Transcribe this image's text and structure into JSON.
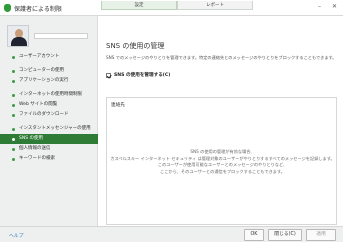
{
  "window": {
    "title": "保護者による制限",
    "controls": {
      "minimize": "–",
      "close": "✕"
    }
  },
  "tabs": [
    {
      "label": "設定"
    },
    {
      "label": "レポート"
    }
  ],
  "sidebar": {
    "username": "",
    "items": [
      {
        "label": "ユーザーアカウント"
      },
      {
        "label": "コンピューターの使用"
      },
      {
        "label": "アプリケーションの実行"
      },
      {
        "label": "インターネットの使用時間制限"
      },
      {
        "label": "Web サイトの閲覧"
      },
      {
        "label": "ファイルのダウンロード"
      },
      {
        "label": "インスタントメッセンジャーの使用"
      },
      {
        "label": "SNS の使用"
      },
      {
        "label": "個人情報の送信"
      },
      {
        "label": "キーワードの検索"
      }
    ],
    "active_index": 7
  },
  "content": {
    "heading": "SNS の使用の管理",
    "description": "SNS でのメッセージのやりとりを管理できます。特定の連絡先とのメッセージのやりとりをブロックすることもできます。",
    "checkbox_label": "SNS の使用を管理する(C)",
    "checkbox_checked": true,
    "contacts_label": "連絡先",
    "contacts_empty_lines": [
      "SNS の使用の管理が有効な場合、",
      "カスペルスキー インターネット セキュリティ は管理対象のユーザーがやりとりするすべてのメッセージを記録します。",
      "このユーザーが使用可能なユーザーとのメッセージのやりとりなど、",
      "ここから、そのユーザーとの通信をブロックすることもできます。"
    ]
  },
  "footer": {
    "help": "ヘルプ",
    "ok": "OK",
    "close": "閉じる(C)",
    "apply": "適用"
  }
}
